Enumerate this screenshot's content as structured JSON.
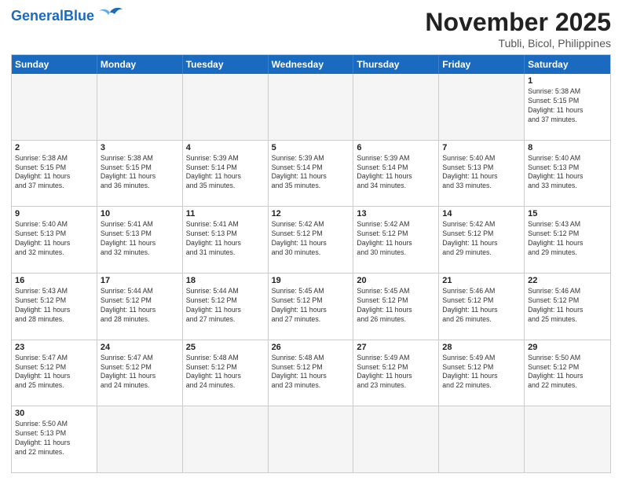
{
  "header": {
    "logo_general": "General",
    "logo_blue": "Blue",
    "month_title": "November 2025",
    "location": "Tubli, Bicol, Philippines"
  },
  "days_of_week": [
    "Sunday",
    "Monday",
    "Tuesday",
    "Wednesday",
    "Thursday",
    "Friday",
    "Saturday"
  ],
  "weeks": [
    [
      {
        "day": "",
        "info": ""
      },
      {
        "day": "",
        "info": ""
      },
      {
        "day": "",
        "info": ""
      },
      {
        "day": "",
        "info": ""
      },
      {
        "day": "",
        "info": ""
      },
      {
        "day": "",
        "info": ""
      },
      {
        "day": "1",
        "info": "Sunrise: 5:38 AM\nSunset: 5:15 PM\nDaylight: 11 hours\nand 37 minutes."
      }
    ],
    [
      {
        "day": "2",
        "info": "Sunrise: 5:38 AM\nSunset: 5:15 PM\nDaylight: 11 hours\nand 37 minutes."
      },
      {
        "day": "3",
        "info": "Sunrise: 5:38 AM\nSunset: 5:15 PM\nDaylight: 11 hours\nand 36 minutes."
      },
      {
        "day": "4",
        "info": "Sunrise: 5:39 AM\nSunset: 5:14 PM\nDaylight: 11 hours\nand 35 minutes."
      },
      {
        "day": "5",
        "info": "Sunrise: 5:39 AM\nSunset: 5:14 PM\nDaylight: 11 hours\nand 35 minutes."
      },
      {
        "day": "6",
        "info": "Sunrise: 5:39 AM\nSunset: 5:14 PM\nDaylight: 11 hours\nand 34 minutes."
      },
      {
        "day": "7",
        "info": "Sunrise: 5:40 AM\nSunset: 5:13 PM\nDaylight: 11 hours\nand 33 minutes."
      },
      {
        "day": "8",
        "info": "Sunrise: 5:40 AM\nSunset: 5:13 PM\nDaylight: 11 hours\nand 33 minutes."
      }
    ],
    [
      {
        "day": "9",
        "info": "Sunrise: 5:40 AM\nSunset: 5:13 PM\nDaylight: 11 hours\nand 32 minutes."
      },
      {
        "day": "10",
        "info": "Sunrise: 5:41 AM\nSunset: 5:13 PM\nDaylight: 11 hours\nand 32 minutes."
      },
      {
        "day": "11",
        "info": "Sunrise: 5:41 AM\nSunset: 5:13 PM\nDaylight: 11 hours\nand 31 minutes."
      },
      {
        "day": "12",
        "info": "Sunrise: 5:42 AM\nSunset: 5:12 PM\nDaylight: 11 hours\nand 30 minutes."
      },
      {
        "day": "13",
        "info": "Sunrise: 5:42 AM\nSunset: 5:12 PM\nDaylight: 11 hours\nand 30 minutes."
      },
      {
        "day": "14",
        "info": "Sunrise: 5:42 AM\nSunset: 5:12 PM\nDaylight: 11 hours\nand 29 minutes."
      },
      {
        "day": "15",
        "info": "Sunrise: 5:43 AM\nSunset: 5:12 PM\nDaylight: 11 hours\nand 29 minutes."
      }
    ],
    [
      {
        "day": "16",
        "info": "Sunrise: 5:43 AM\nSunset: 5:12 PM\nDaylight: 11 hours\nand 28 minutes."
      },
      {
        "day": "17",
        "info": "Sunrise: 5:44 AM\nSunset: 5:12 PM\nDaylight: 11 hours\nand 28 minutes."
      },
      {
        "day": "18",
        "info": "Sunrise: 5:44 AM\nSunset: 5:12 PM\nDaylight: 11 hours\nand 27 minutes."
      },
      {
        "day": "19",
        "info": "Sunrise: 5:45 AM\nSunset: 5:12 PM\nDaylight: 11 hours\nand 27 minutes."
      },
      {
        "day": "20",
        "info": "Sunrise: 5:45 AM\nSunset: 5:12 PM\nDaylight: 11 hours\nand 26 minutes."
      },
      {
        "day": "21",
        "info": "Sunrise: 5:46 AM\nSunset: 5:12 PM\nDaylight: 11 hours\nand 26 minutes."
      },
      {
        "day": "22",
        "info": "Sunrise: 5:46 AM\nSunset: 5:12 PM\nDaylight: 11 hours\nand 25 minutes."
      }
    ],
    [
      {
        "day": "23",
        "info": "Sunrise: 5:47 AM\nSunset: 5:12 PM\nDaylight: 11 hours\nand 25 minutes."
      },
      {
        "day": "24",
        "info": "Sunrise: 5:47 AM\nSunset: 5:12 PM\nDaylight: 11 hours\nand 24 minutes."
      },
      {
        "day": "25",
        "info": "Sunrise: 5:48 AM\nSunset: 5:12 PM\nDaylight: 11 hours\nand 24 minutes."
      },
      {
        "day": "26",
        "info": "Sunrise: 5:48 AM\nSunset: 5:12 PM\nDaylight: 11 hours\nand 23 minutes."
      },
      {
        "day": "27",
        "info": "Sunrise: 5:49 AM\nSunset: 5:12 PM\nDaylight: 11 hours\nand 23 minutes."
      },
      {
        "day": "28",
        "info": "Sunrise: 5:49 AM\nSunset: 5:12 PM\nDaylight: 11 hours\nand 22 minutes."
      },
      {
        "day": "29",
        "info": "Sunrise: 5:50 AM\nSunset: 5:12 PM\nDaylight: 11 hours\nand 22 minutes."
      }
    ],
    [
      {
        "day": "30",
        "info": "Sunrise: 5:50 AM\nSunset: 5:13 PM\nDaylight: 11 hours\nand 22 minutes."
      },
      {
        "day": "",
        "info": ""
      },
      {
        "day": "",
        "info": ""
      },
      {
        "day": "",
        "info": ""
      },
      {
        "day": "",
        "info": ""
      },
      {
        "day": "",
        "info": ""
      },
      {
        "day": "",
        "info": ""
      }
    ]
  ]
}
